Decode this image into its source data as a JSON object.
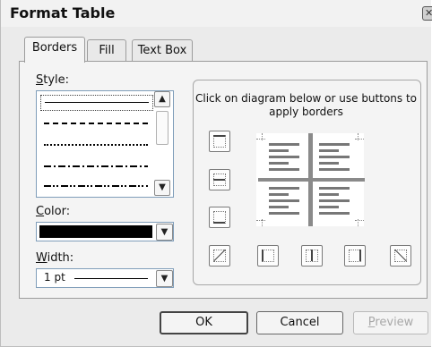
{
  "window": {
    "title": "Format Table",
    "close_glyph": "✕"
  },
  "tabs": [
    {
      "label": "Borders",
      "active": true
    },
    {
      "label": "Fill",
      "active": false
    },
    {
      "label": "Text Box",
      "active": false
    }
  ],
  "borders": {
    "style_label": {
      "mnemonic": "S",
      "rest": "tyle:"
    },
    "style_options": [
      "solid",
      "dashed",
      "dotted",
      "dash-dot",
      "dash-dot-dot"
    ],
    "selected_style": "solid",
    "color_label": {
      "mnemonic": "C",
      "rest": "olor:"
    },
    "color_value": "#000000",
    "width_label": {
      "mnemonic": "W",
      "rest": "idth:"
    },
    "width_value": "1 pt",
    "instructions": "Click on diagram below or use buttons to apply borders",
    "buttons": [
      "border-top-icon",
      "border-inside-horizontal-icon",
      "border-bottom-icon",
      "diagonal-up-icon",
      "border-left-icon",
      "border-inside-vertical-icon",
      "border-right-icon",
      "diagonal-down-icon"
    ]
  },
  "footer": {
    "ok_label": "OK",
    "cancel_label": "Cancel",
    "preview_label": {
      "mnemonic": "P",
      "rest": "review"
    }
  },
  "colors": {
    "dialog_bg": "#ebebeb",
    "panel_bg": "#f4f4f4",
    "field_border": "#7f9db9"
  }
}
